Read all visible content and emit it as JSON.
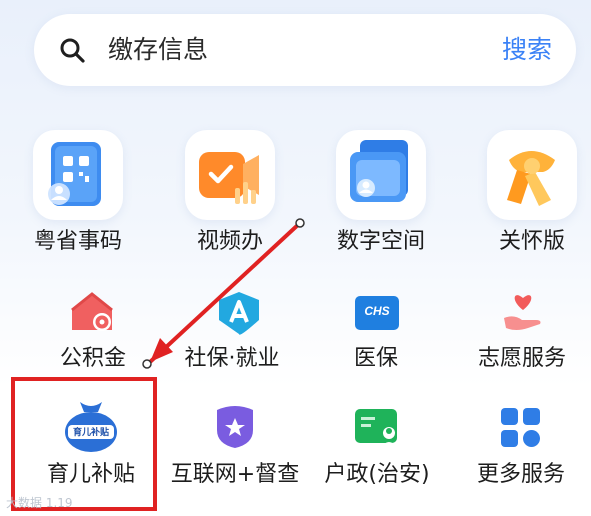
{
  "search": {
    "placeholder_text": "缴存信息",
    "button_label": "搜索"
  },
  "row1": [
    {
      "label": "粤省事码",
      "icon": "qr-code-icon"
    },
    {
      "label": "视频办",
      "icon": "video-camera-icon"
    },
    {
      "label": "数字空间",
      "icon": "digital-folder-icon"
    },
    {
      "label": "关怀版",
      "icon": "scarf-icon"
    }
  ],
  "row2": [
    {
      "label": "公积金",
      "icon": "house-fund-icon"
    },
    {
      "label": "社保·就业",
      "icon": "social-security-icon"
    },
    {
      "label": "医保",
      "icon": "chs-medical-insurance-icon",
      "badge": "CHS"
    },
    {
      "label": "志愿服务",
      "icon": "heart-hand-icon"
    }
  ],
  "row3": [
    {
      "label": "育儿补贴",
      "icon": "childcare-subsidy-bag-icon",
      "bag_text": "育儿补贴"
    },
    {
      "label": "互联网+督查",
      "icon": "star-shield-icon"
    },
    {
      "label": "户政(治安)",
      "icon": "id-card-person-icon"
    },
    {
      "label": "更多服务",
      "icon": "grid-four-icon"
    }
  ],
  "watermark": "大数据 1.19",
  "colors": {
    "accent": "#3b82f6",
    "annotation": "#e02222",
    "text": "#1d1d1d"
  }
}
